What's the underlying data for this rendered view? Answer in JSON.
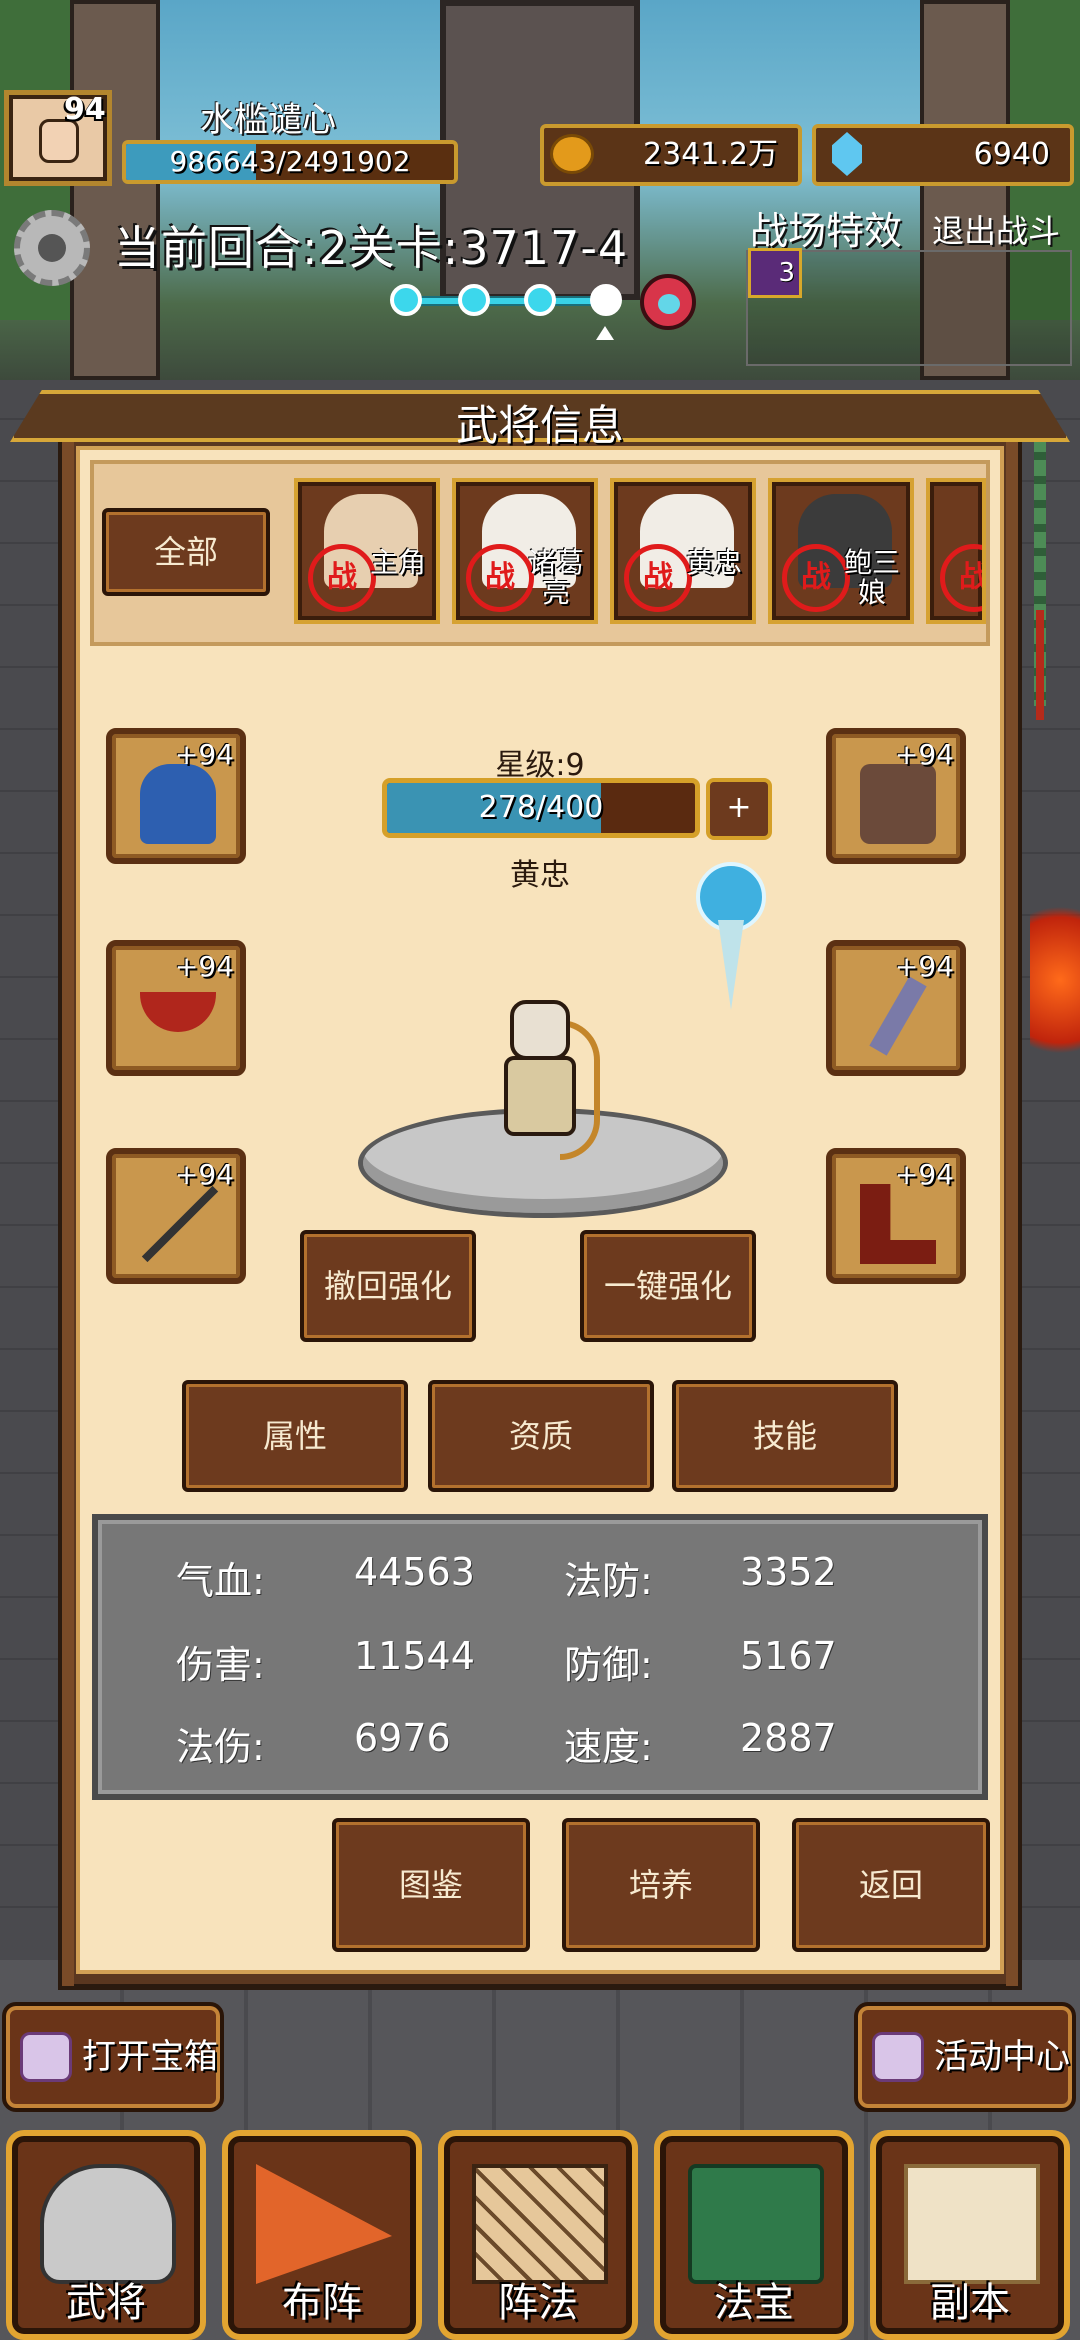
{
  "player": {
    "level": "94",
    "name": "水槛谴心",
    "hp_text": "986643/2491902",
    "hp_fraction": 0.396
  },
  "resources": {
    "gold": "2341.2万",
    "gems": "6940"
  },
  "battle": {
    "round_text": "当前回合:2关卡:3717-4",
    "effect_label": "战场特效",
    "exit_label": "退出战斗",
    "effect_count": "3",
    "stage_progress_fraction": 0.8
  },
  "panel": {
    "title": "武将信息",
    "filter_all": "全部",
    "heroes": [
      {
        "mark": "战",
        "name": "主角"
      },
      {
        "mark": "战",
        "name": "诸葛亮"
      },
      {
        "mark": "战",
        "name": "黄忠"
      },
      {
        "mark": "战",
        "name": "鲍三娘"
      },
      {
        "mark": "战",
        "name": ""
      }
    ],
    "equipment_level": "+94",
    "star_label": "星级:9",
    "exp_text": "278/400",
    "exp_fraction": 0.695,
    "exp_plus": "+",
    "hero_name": "黄忠",
    "revoke_button": "撤回强化",
    "auto_upgrade_button": "一键强化",
    "tabs": [
      "属性",
      "资质",
      "技能"
    ],
    "stats": {
      "hp_label": "气血:",
      "hp_value": "44563",
      "mdef_label": "法防:",
      "mdef_value": "3352",
      "dmg_label": "伤害:",
      "dmg_value": "11544",
      "def_label": "防御:",
      "def_value": "5167",
      "mdmg_label": "法伤:",
      "mdmg_value": "6976",
      "speed_label": "速度:",
      "speed_value": "2887"
    },
    "gallery_button": "图鉴",
    "train_button": "培养",
    "back_button": "返回"
  },
  "bottom": {
    "open_chest": "打开宝箱",
    "activity_center": "活动中心",
    "nav": [
      "武将",
      "布阵",
      "阵法",
      "法宝",
      "副本"
    ]
  },
  "colors": {
    "panel_bg": "#f8e3bc",
    "button_brown": "#6d3a1e",
    "border_gold": "#d5a029",
    "bar_blue": "#3a93b3",
    "battle_mark_red": "#e01b1b"
  },
  "icons": {
    "gold": "gold-coin-icon",
    "gem": "blue-gem-icon",
    "settings": "gear-icon",
    "boss": "boss-demon-icon",
    "effect": "battle-effect-icon",
    "chest": "chest-icon",
    "activity": "activity-icon"
  }
}
